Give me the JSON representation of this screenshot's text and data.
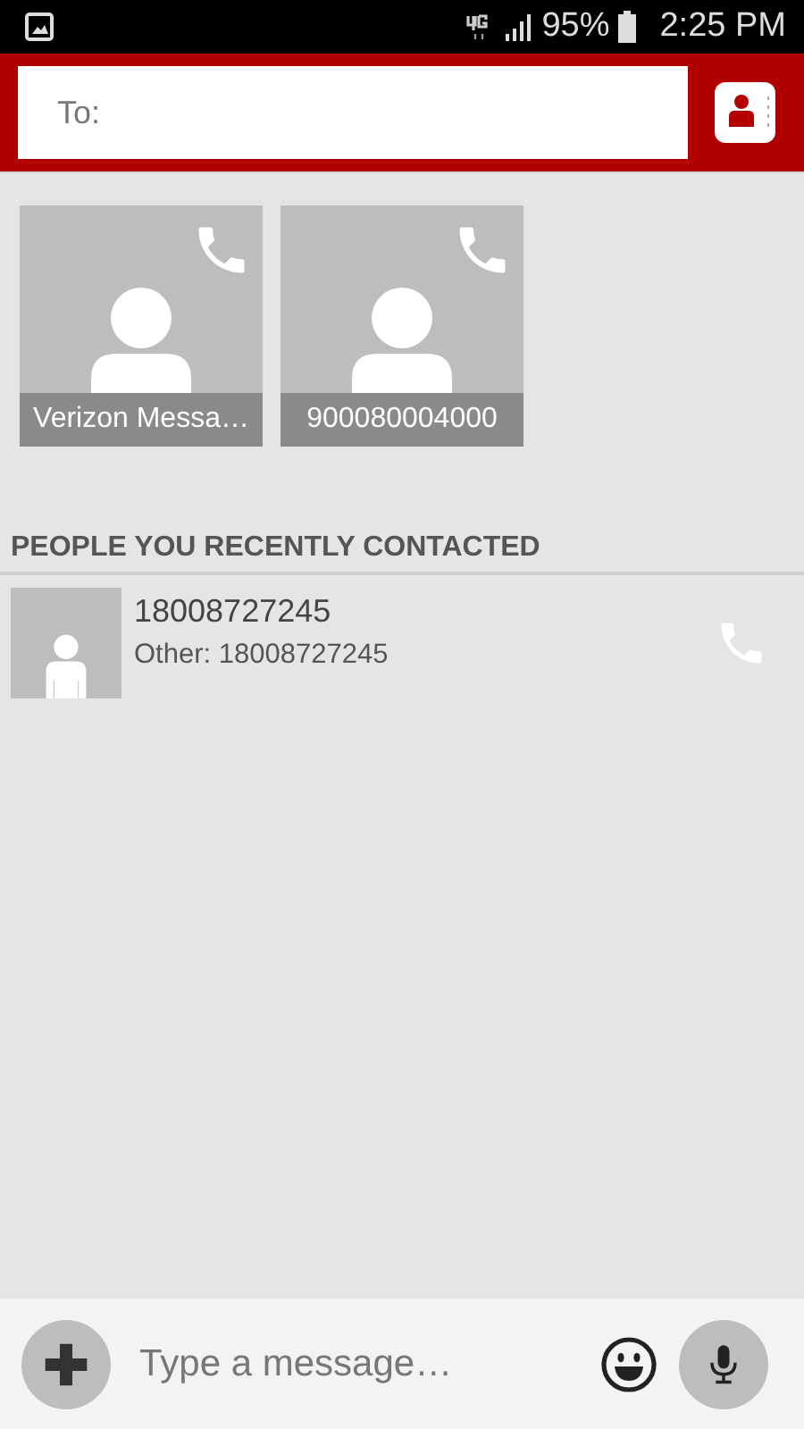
{
  "status_bar": {
    "battery": "95%",
    "time": "2:25 PM"
  },
  "recipient_field": {
    "placeholder": "To:"
  },
  "favorites": [
    {
      "label": "Verizon Messa…"
    },
    {
      "label": "900080004000"
    }
  ],
  "recent_section": {
    "title": "PEOPLE YOU RECENTLY CONTACTED",
    "contacts": [
      {
        "name": "18008727245",
        "detail": "Other: 18008727245"
      }
    ]
  },
  "composer": {
    "placeholder": "Type a message…"
  }
}
